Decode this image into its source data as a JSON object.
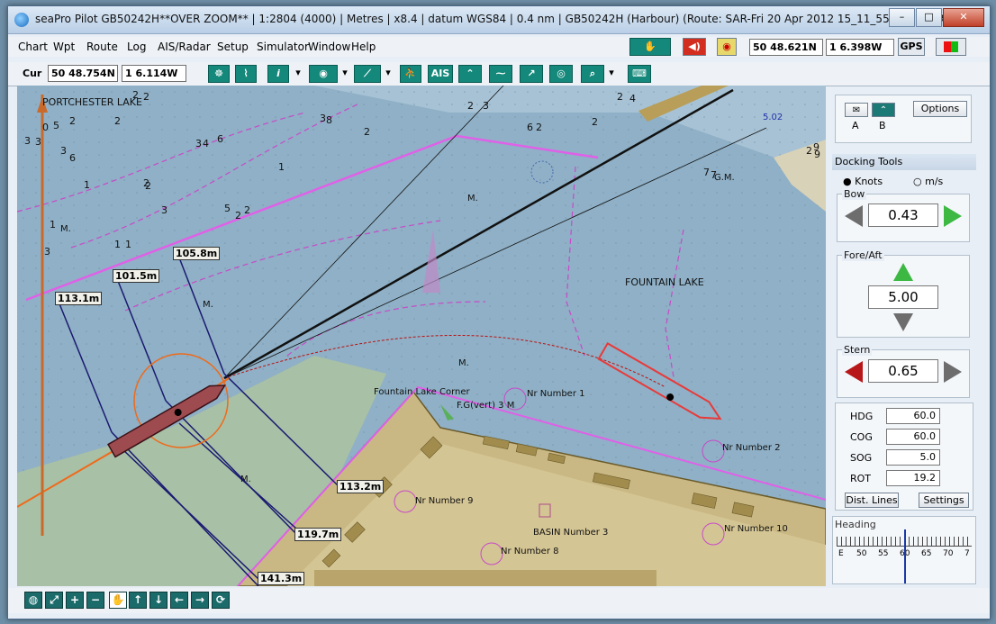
{
  "window": {
    "title": "seaPro Pilot GB50242H**OVER ZOOM**  | 1:2804 (4000) | Metres | x8.4 | datum WGS84 | 0.4 nm | GB50242H (Harbour) (Route: SAR-Fri 20 Apr 2012 15_11_55, Log: SAR-",
    "min_label": "–",
    "max_label": "□",
    "close_label": "✕"
  },
  "menu": [
    "Chart",
    "Wpt",
    "Route",
    "Log",
    "AIS/Radar",
    "Setup",
    "Simulator",
    "Window",
    "Help"
  ],
  "status": {
    "lat": "50 48.621N",
    "lon": "1  6.398W",
    "gps_label": "GPS"
  },
  "toolbar": {
    "cur_label": "Cur",
    "cur_lat": "50 48.754N",
    "cur_lon": "1  6.114W",
    "info_label": "i",
    "ais_label": "AIS"
  },
  "map": {
    "place_labels": {
      "portchester": "PORTCHESTER LAKE",
      "fountain_lake": "FOUNTAIN LAKE",
      "fountain_corner": "Fountain Lake Corner",
      "fgiven": "F.G(vert) 3 M",
      "nr1": "Nr Number 1",
      "nr2": "Nr Number 2",
      "nr8": "Nr Number 8",
      "nr9": "Nr Number 9",
      "nr10": "Nr Number 10",
      "basin3": "BASIN Number 3",
      "gm": "G.M.",
      "m1": "M.",
      "m2": "M.",
      "m3": "M.",
      "m4": "M.",
      "m5": "M.",
      "contour": "5.02"
    },
    "ranges": [
      "113.1m",
      "101.5m",
      "105.8m",
      "113.2m",
      "119.7m",
      "141.3m"
    ],
    "depths": [
      "2",
      "2",
      "5",
      "3",
      "3",
      "0",
      "3",
      "6",
      "2",
      "2",
      "2",
      "2",
      "3",
      "1",
      "3",
      "1",
      "3",
      "4",
      "2",
      "1",
      "1",
      "8",
      "2",
      "7",
      "2",
      "3",
      "2",
      "6",
      "2",
      "1",
      "2",
      "4",
      "9",
      "2",
      "7",
      "9",
      "5",
      "6",
      "2",
      "3"
    ]
  },
  "panel": {
    "options_label": "Options",
    "tab_a": "A",
    "tab_b": "B",
    "docking_title": "Docking Tools",
    "knots_label": "Knots",
    "ms_label": "m/s",
    "bow_label": "Bow",
    "bow_value": "0.43",
    "foreaft_label": "Fore/Aft",
    "foreaft_value": "5.00",
    "stern_label": "Stern",
    "stern_value": "0.65",
    "hdg_label": "HDG",
    "hdg_value": "60.0",
    "cog_label": "COG",
    "cog_value": "60.0",
    "sog_label": "SOG",
    "sog_value": "5.0",
    "rot_label": "ROT",
    "rot_value": "19.2",
    "dist_lines_label": "Dist. Lines",
    "settings_label": "Settings",
    "heading_label": "Heading",
    "heading_scale": [
      "E",
      "50",
      "55",
      "60",
      "65",
      "70",
      "7"
    ]
  },
  "colors": {
    "sea": "#8fb0c6",
    "land": "#c8b781",
    "drying": "#a9c1a6",
    "track": "#e040e0",
    "ship": "#9e4b50",
    "green_arrow": "#3cb843",
    "red_arrow": "#b8171a",
    "grey_arrow": "#6d6d6d"
  }
}
